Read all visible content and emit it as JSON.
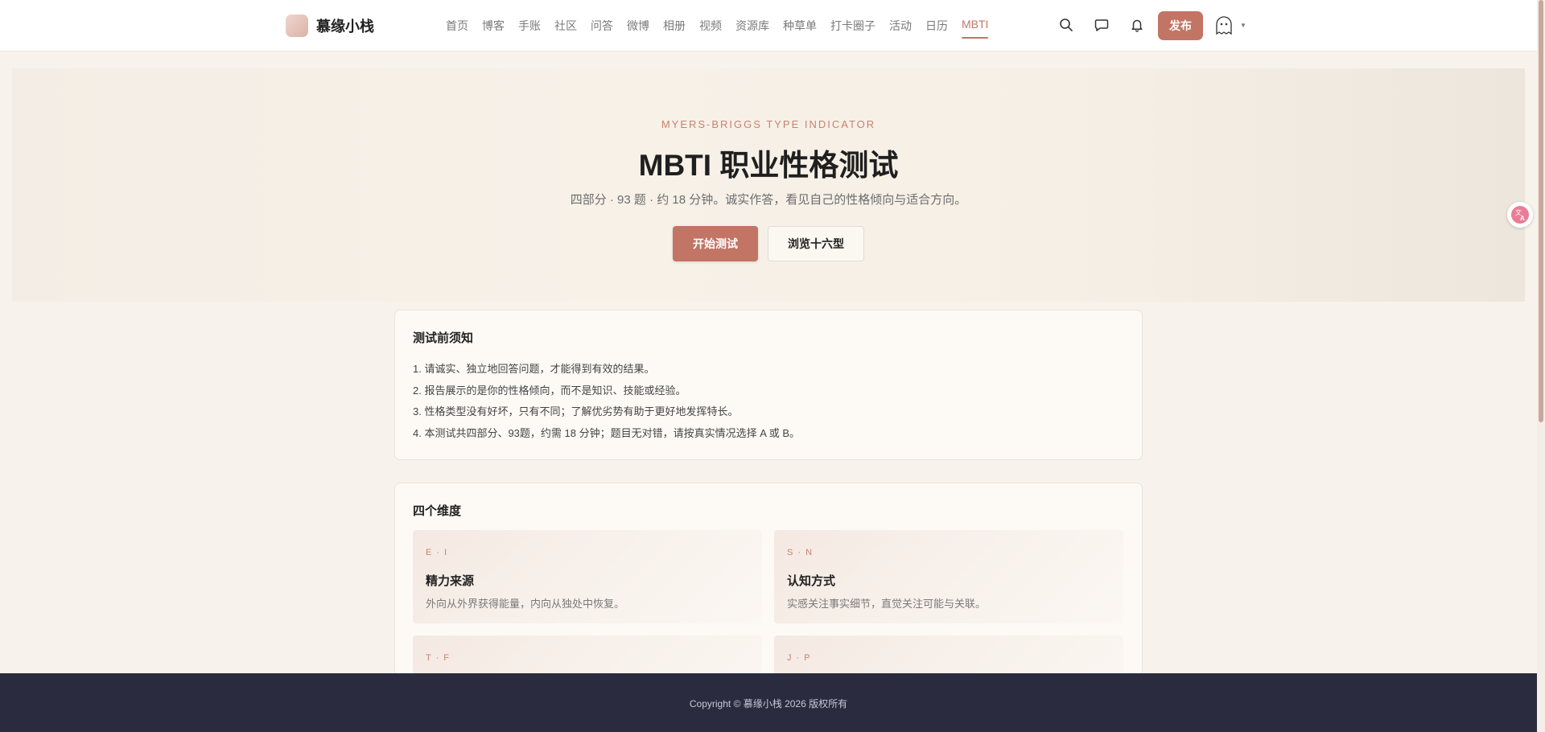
{
  "site": {
    "brand_name": "慕缘小栈",
    "brand_color": "#c27565"
  },
  "nav": {
    "items": [
      {
        "label": "首页"
      },
      {
        "label": "博客"
      },
      {
        "label": "手账"
      },
      {
        "label": "社区"
      },
      {
        "label": "问答"
      },
      {
        "label": "微博"
      },
      {
        "label": "相册"
      },
      {
        "label": "视频"
      },
      {
        "label": "资源库"
      },
      {
        "label": "种草单"
      },
      {
        "label": "打卡圈子"
      },
      {
        "label": "活动"
      },
      {
        "label": "日历"
      },
      {
        "label": "MBTI"
      }
    ],
    "active": "MBTI"
  },
  "header_actions": {
    "icons": [
      "search-icon",
      "message-icon",
      "bell-icon"
    ],
    "publish_label": "发布"
  },
  "hero": {
    "kicker": "MYERS-BRIGGS TYPE INDICATOR",
    "title": "MBTI 职业性格测试",
    "subtitle": "四部分 · 93 题 · 约 18 分钟。诚实作答，看见自己的性格倾向与适合方向。",
    "start_label": "开始测试",
    "browse_label": "浏览十六型"
  },
  "notice": {
    "title": "测试前须知",
    "items": [
      "1. 请诚实、独立地回答问题，才能得到有效的结果。",
      "2. 报告展示的是你的性格倾向，而不是知识、技能或经验。",
      "3. 性格类型没有好坏，只有不同；了解优劣势有助于更好地发挥特长。",
      "4. 本测试共四部分、93题，约需 18 分钟；题目无对错，请按真实情况选择 A 或 B。"
    ]
  },
  "dimensions": {
    "title": "四个维度",
    "items": [
      {
        "code": "E · I",
        "name": "精力来源",
        "desc": "外向从外界获得能量，内向从独处中恢复。"
      },
      {
        "code": "S · N",
        "name": "认知方式",
        "desc": "实感关注事实细节，直觉关注可能与关联。"
      },
      {
        "code": "T · F",
        "name": "",
        "desc": ""
      },
      {
        "code": "J · P",
        "name": "",
        "desc": ""
      }
    ]
  },
  "footer": {
    "copyright": "Copyright © 慕缘小栈 2026 版权所有"
  }
}
